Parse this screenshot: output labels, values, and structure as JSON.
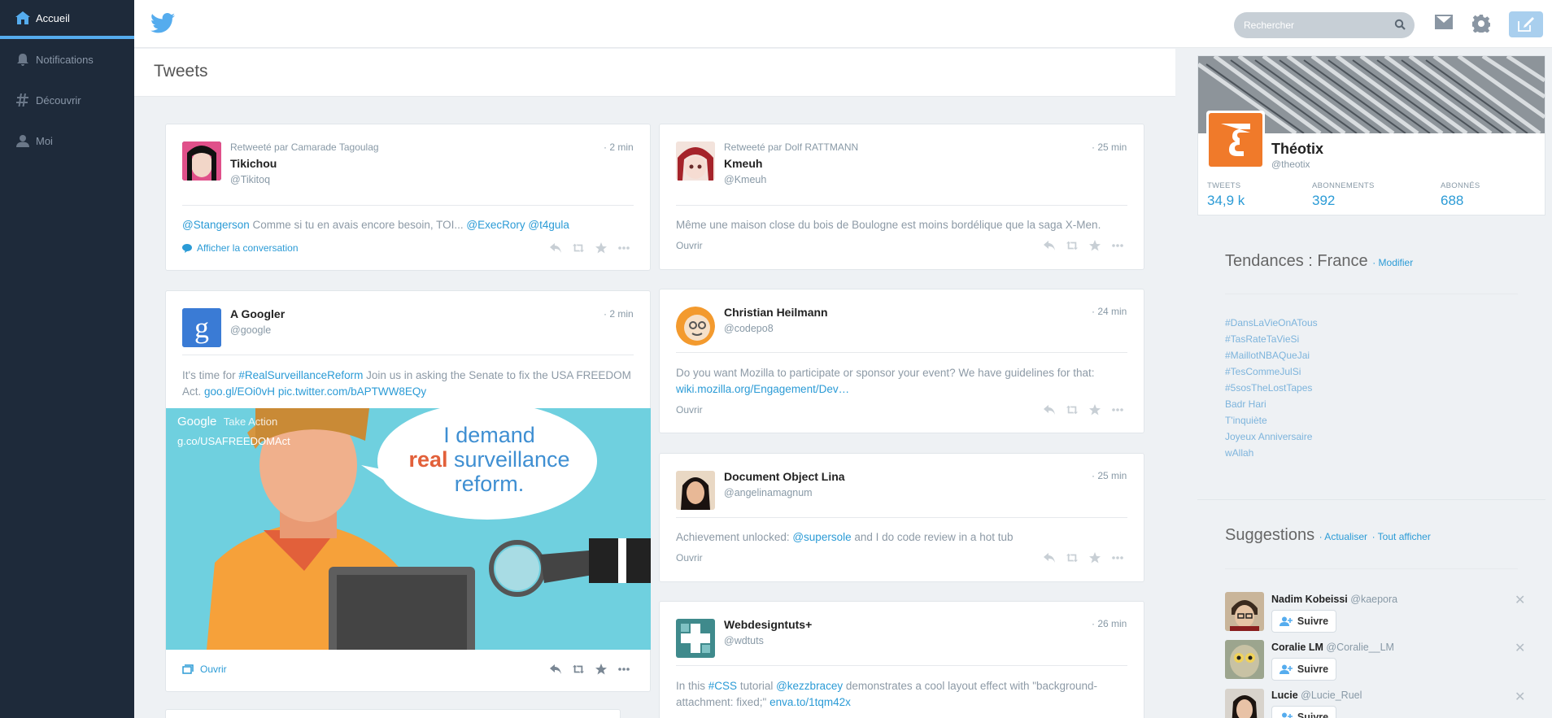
{
  "sidebar": {
    "items": [
      {
        "label": "Accueil",
        "icon": "home-icon"
      },
      {
        "label": "Notifications",
        "icon": "bell-icon"
      },
      {
        "label": "Découvrir",
        "icon": "hashtag-icon"
      },
      {
        "label": "Moi",
        "icon": "user-icon"
      }
    ]
  },
  "topbar": {
    "search_placeholder": "Rechercher",
    "accent": "#55acee"
  },
  "page": {
    "title": "Tweets"
  },
  "tweets": [
    {
      "retweeted_by": "Retweeté par Camarade Tagoulag",
      "name": "Tikichou",
      "handle": "@Tikitoq",
      "time": "· 2 min",
      "text_parts": [
        "@Stangerson",
        " Comme si tu en avais encore besoin, TOI... ",
        "@ExecRory",
        " ",
        "@t4gula"
      ],
      "footer": "Afficher la conversation"
    },
    {
      "name": "A Googler",
      "handle": "@google",
      "time": "· 2 min",
      "text_parts": [
        "It's time for ",
        "#RealSurveillanceReform",
        " Join us in asking the Senate to fix the USA FREEDOM Act. ",
        "goo.gl/EOi0vH",
        " ",
        "pic.twitter.com/bAPTWW8EQy"
      ],
      "image": {
        "brand": "Google",
        "action": "Take Action",
        "url": "g.co/USAFREEDOMAct",
        "bubble_line1": "I demand",
        "bubble_real": "real",
        "bubble_rest": " surveillance",
        "bubble_line3": "reform."
      },
      "footer": "Ouvrir"
    },
    {
      "retweeted_by": "Retweeté par Dolf RATTMANN",
      "name": "Kmeuh",
      "handle": "@Kmeuh",
      "time": "· 25 min",
      "text": "Même une maison close du bois de Boulogne est moins bordélique que la saga X-Men.",
      "footer": "Ouvrir"
    },
    {
      "name": "Christian Heilmann",
      "handle": "@codepo8",
      "time": "· 24 min",
      "text": "Do you want Mozilla to participate or sponsor your event? We have guidelines for that:",
      "link": "wiki.mozilla.org/Engagement/Dev…",
      "footer": "Ouvrir"
    },
    {
      "name": "Document Object Lina",
      "handle": "@angelinamagnum",
      "time": "· 25 min",
      "text_parts": [
        "Achievement unlocked: ",
        "@supersole",
        " and I do code review in a hot tub"
      ],
      "footer": "Ouvrir"
    },
    {
      "name": "Webdesigntuts+",
      "handle": "@wdtuts",
      "time": "· 26 min",
      "text_parts": [
        "In this ",
        "#CSS",
        " tutorial ",
        "@kezzbracey",
        " demonstrates a cool layout effect with \"background-attachment: fixed;\" ",
        "enva.to/1tqm42x"
      ]
    }
  ],
  "profile": {
    "name": "Théotix",
    "handle": "@theotix",
    "stats": [
      {
        "label": "TWEETS",
        "value": "34,9 k"
      },
      {
        "label": "ABONNEMENTS",
        "value": "392"
      },
      {
        "label": "ABONNÉS",
        "value": "688"
      }
    ],
    "brand_color": "#f07a2a"
  },
  "trends": {
    "title": "Tendances : France",
    "edit": "· Modifier",
    "items": [
      "#DansLaVieOnATous",
      "#TasRateTaVieSi",
      "#MaillotNBAQueJai",
      "#TesCommeJulSi",
      "#5sosTheLostTapes",
      "Badr Hari",
      "T'inquiète",
      "Joyeux Anniversaire",
      "wAllah"
    ]
  },
  "suggestions": {
    "title": "Suggestions",
    "refresh": "· Actualiser",
    "view_all": "· Tout afficher",
    "follow_label": "Suivre",
    "users": [
      {
        "name": "Nadim Kobeissi",
        "handle": "@kaepora"
      },
      {
        "name": "Coralie LM",
        "handle": "@Coralie__LM"
      },
      {
        "name": "Lucie",
        "handle": "@Lucie_Ruel"
      }
    ]
  }
}
